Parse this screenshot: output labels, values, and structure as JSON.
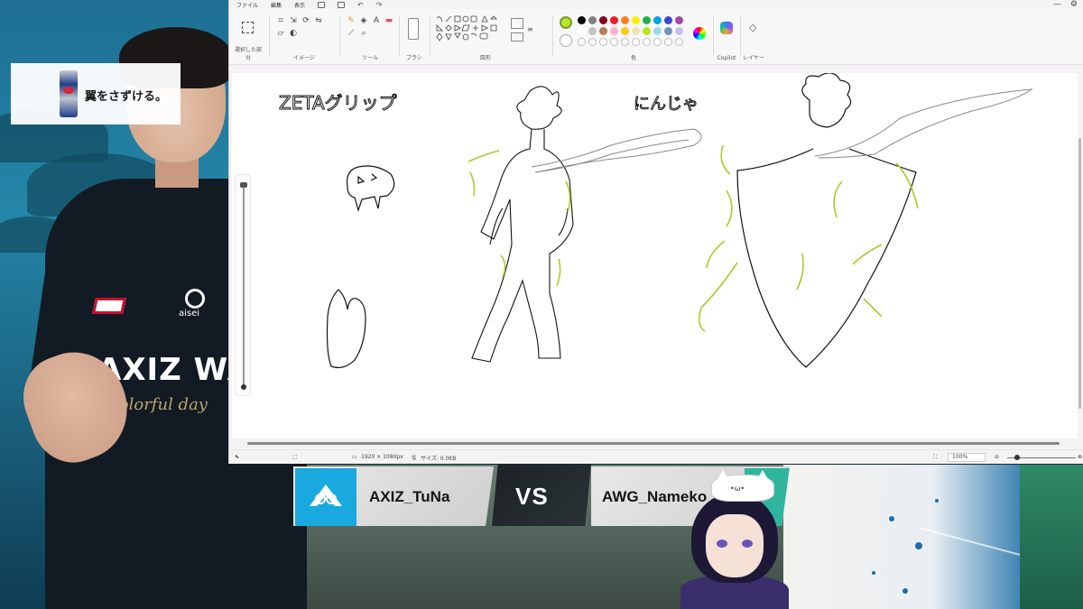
{
  "paint": {
    "menu": [
      "ファイル",
      "編集",
      "表示"
    ],
    "groups": {
      "selection": "選択した部分",
      "image": "イメージ",
      "tools": "ツール",
      "brushes": "ブラシ",
      "shapes": "図形",
      "colors": "色",
      "copilot": "Copilot",
      "layers": "レイヤー"
    },
    "palette_row1": [
      "#000000",
      "#7f7f7f",
      "#880015",
      "#ed1c24",
      "#ff7f27",
      "#fff200",
      "#22b14c",
      "#00a2e8",
      "#3f48cc",
      "#a349a4"
    ],
    "palette_row2": [
      "#ffffff",
      "#c3c3c3",
      "#b97a57",
      "#ffaec9",
      "#ffc90e",
      "#efe4b0",
      "#b5e61d",
      "#99d9ea",
      "#7092be",
      "#c8bfe7"
    ],
    "current_color": "#b6e532",
    "canvas_text": {
      "left_label": "ZETAグリップ",
      "right_label": "にんじゃ"
    },
    "status": {
      "dimensions": "1920 × 1080px",
      "size": "サイズ: 0.0KB",
      "zoom": "100%"
    }
  },
  "sponsor": {
    "tagline": "翼をさずける。",
    "brand_colors": {
      "blue": "#1f3f8a",
      "red": "#d7263d"
    }
  },
  "player": {
    "jersey_text": "AXIZ WAVE",
    "jersey_sub": "Colorful day",
    "sponsor_text": "aisei"
  },
  "match": {
    "left_team": "AXIZ_TuNa",
    "vs": "VS",
    "right_team": "AWG_Nameko",
    "left_color": "#1aa9de",
    "right_color": "#2fb59e"
  },
  "icons": [
    "select-icon",
    "crop-icon",
    "resize-icon",
    "rotate-icon",
    "pencil-icon",
    "fill-icon",
    "text-icon",
    "eraser-icon",
    "picker-icon",
    "magnifier-icon",
    "brush-icon",
    "color-wheel-icon",
    "copilot-icon",
    "layers-icon",
    "minimize-icon",
    "settings-icon"
  ]
}
